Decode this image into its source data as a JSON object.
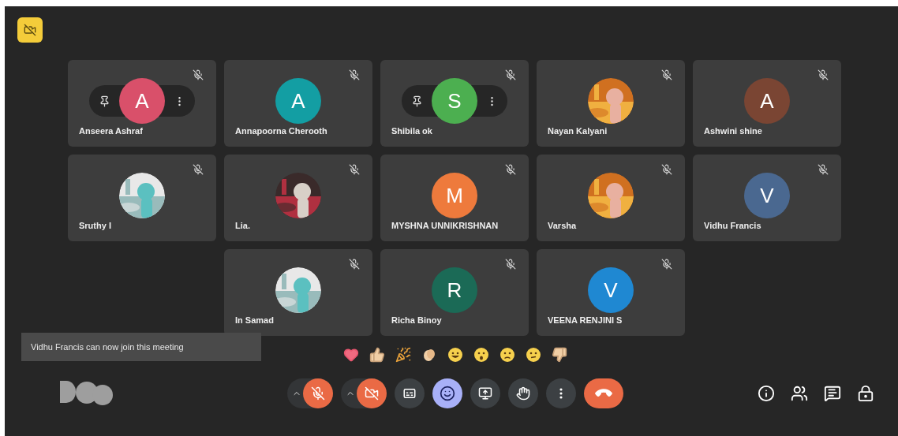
{
  "participants": [
    {
      "name": "Anseera Ashraf",
      "avatar": {
        "kind": "letter",
        "letter": "A",
        "color": "#d9506a"
      },
      "muted": true,
      "hover_controls": true
    },
    {
      "name": "Annapoorna Cherooth",
      "avatar": {
        "kind": "letter",
        "letter": "A",
        "color": "#139ea3"
      },
      "muted": true,
      "hover_controls": false
    },
    {
      "name": "Shibila ok",
      "avatar": {
        "kind": "letter",
        "letter": "S",
        "color": "#4caf50"
      },
      "muted": true,
      "hover_controls": true
    },
    {
      "name": "Nayan Kalyani",
      "muted": true,
      "hover_controls": false
    },
    {
      "name": "Ashwini shine",
      "avatar": {
        "kind": "letter",
        "letter": "A",
        "color": "#7a4533"
      },
      "muted": true,
      "hover_controls": false
    },
    {
      "name": "Sruthy I",
      "muted": true,
      "hover_controls": false
    },
    {
      "name": "Lia.",
      "muted": true,
      "hover_controls": false
    },
    {
      "name": "MYSHNA UNNIKRISHNAN",
      "avatar": {
        "kind": "letter",
        "letter": "M",
        "color": "#ee7a3c"
      },
      "muted": true,
      "hover_controls": false
    },
    {
      "name": "Varsha",
      "muted": true,
      "hover_controls": false
    },
    {
      "name": "Vidhu Francis",
      "avatar": {
        "kind": "letter",
        "letter": "V",
        "color": "#4a6890"
      },
      "muted": true,
      "hover_controls": false
    },
    {
      "name": "In Samad",
      "muted": true,
      "hover_controls": false
    },
    {
      "name": "Richa Binoy",
      "avatar": {
        "kind": "letter",
        "letter": "R",
        "color": "#1b6a56"
      },
      "muted": true,
      "hover_controls": false
    },
    {
      "name": "VEENA RENJINI S",
      "avatar": {
        "kind": "letter",
        "letter": "V",
        "color": "#1f88d2"
      },
      "muted": true,
      "hover_controls": false
    }
  ],
  "notification": {
    "text": "Vidhu Francis can now join this meeting"
  },
  "reactions": [
    {
      "kind": "heart"
    },
    {
      "kind": "thumbs-up"
    },
    {
      "kind": "party"
    },
    {
      "kind": "clap"
    },
    {
      "kind": "laugh"
    },
    {
      "kind": "surprised"
    },
    {
      "kind": "sad"
    },
    {
      "kind": "thinking"
    },
    {
      "kind": "thumbs-down"
    }
  ],
  "controls": [
    {
      "kind": "microphone",
      "on": false
    },
    {
      "kind": "camera",
      "on": false
    },
    {
      "kind": "captions",
      "on": false
    },
    {
      "kind": "reactions",
      "on": true
    },
    {
      "kind": "present"
    },
    {
      "kind": "raise-hand",
      "on": false
    },
    {
      "kind": "more"
    },
    {
      "kind": "leave"
    }
  ],
  "side_controls": [
    {
      "kind": "info"
    },
    {
      "kind": "people"
    },
    {
      "kind": "chat"
    },
    {
      "kind": "host-controls"
    }
  ]
}
